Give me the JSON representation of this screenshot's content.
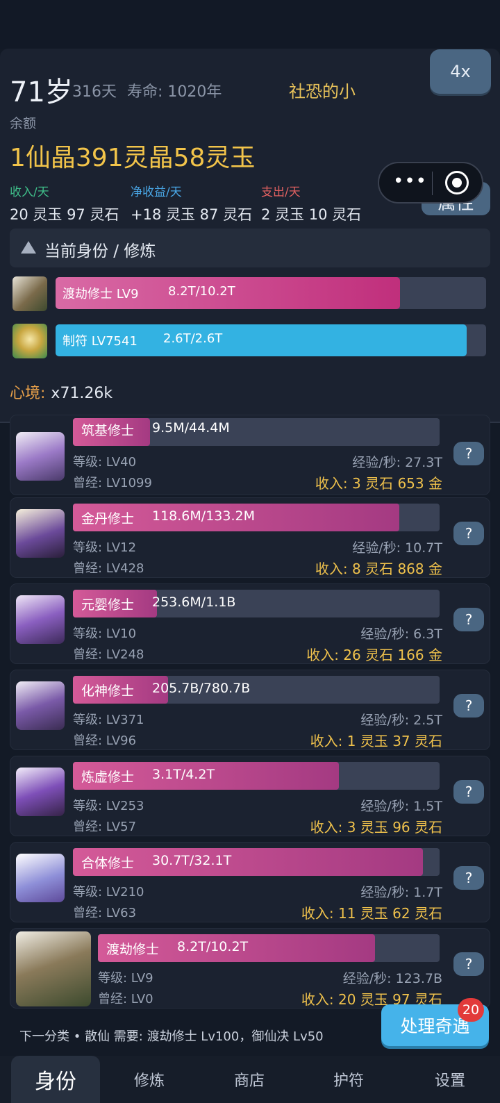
{
  "header": {
    "age": "71岁",
    "days": "316天",
    "lifespan": "寿命: 1020年",
    "player_name": "社恐的小",
    "speed": "4x",
    "balance_label": "余额",
    "balance": "1仙晶391灵晶58灵玉",
    "income_label": "收入/天",
    "income": "20 灵玉 97 灵石",
    "net_label": "净收益/天",
    "net": "+18 灵玉 87 灵石",
    "expense_label": "支出/天",
    "expense": "2 灵玉 10 灵石",
    "capsule_dots": "•••",
    "attr_button": "属性",
    "section_title": "当前身份 / 修炼",
    "mood_label": "心境:",
    "mood_value": "x71.26k",
    "colors": {
      "income": "#3fbf8a",
      "net": "#4aa8e8",
      "expense": "#e06060",
      "gold": "#f2c44a"
    }
  },
  "current": [
    {
      "name": "渡劫修士 LV9",
      "progress": "8.2T/10.2T",
      "fill": 0.8,
      "color": "#cc3f84"
    },
    {
      "name": "制符 LV7541",
      "progress": "2.6T/2.6T",
      "fill": 0.99,
      "color": "#33b2e2"
    }
  ],
  "cards": [
    {
      "rank": "筑基修士",
      "progress": "9.5M/44.4M",
      "fill": 0.21,
      "level": "等级: LV40",
      "prev": "曾经: LV1099",
      "xp": "经验/秒: 27.3T",
      "income": "收入: 3 灵石 653 金"
    },
    {
      "rank": "金丹修士",
      "progress": "118.6M/133.2M",
      "fill": 0.89,
      "level": "等级: LV12",
      "prev": "曾经: LV428",
      "xp": "经验/秒: 10.7T",
      "income": "收入: 8 灵石 868 金"
    },
    {
      "rank": "元婴修士",
      "progress": "253.6M/1.1B",
      "fill": 0.23,
      "level": "等级: LV10",
      "prev": "曾经: LV248",
      "xp": "经验/秒: 6.3T",
      "income": "收入: 26 灵石 166 金"
    },
    {
      "rank": "化神修士",
      "progress": "205.7B/780.7B",
      "fill": 0.26,
      "level": "等级: LV371",
      "prev": "曾经: LV96",
      "xp": "经验/秒: 2.5T",
      "income": "收入: 1 灵玉 37 灵石"
    },
    {
      "rank": "炼虚修士",
      "progress": "3.1T/4.2T",
      "fill": 0.72,
      "level": "等级: LV253",
      "prev": "曾经: LV57",
      "xp": "经验/秒: 1.5T",
      "income": "收入: 3 灵玉 96 灵石"
    },
    {
      "rank": "合体修士",
      "progress": "30.7T/32.1T",
      "fill": 0.96,
      "level": "等级: LV210",
      "prev": "曾经: LV63",
      "xp": "经验/秒: 1.7T",
      "income": "收入: 11 灵玉 62 灵石"
    },
    {
      "rank": "渡劫修士",
      "progress": "8.2T/10.2T",
      "fill": 0.81,
      "level": "等级: LV9",
      "prev": "曾经: LV0",
      "xp": "经验/秒: 123.7B",
      "income": "收入: 20 灵玉 97 灵石"
    }
  ],
  "help_label": "?",
  "next_category": "下一分类 • 散仙 需要: 渡劫修士 Lv100，御仙决 Lv50",
  "event_button": "处理奇遇",
  "event_badge": "20",
  "tabs": [
    {
      "label": "身份",
      "active": true
    },
    {
      "label": "修炼",
      "active": false
    },
    {
      "label": "商店",
      "active": false
    },
    {
      "label": "护符",
      "active": false
    },
    {
      "label": "设置",
      "active": false
    }
  ]
}
